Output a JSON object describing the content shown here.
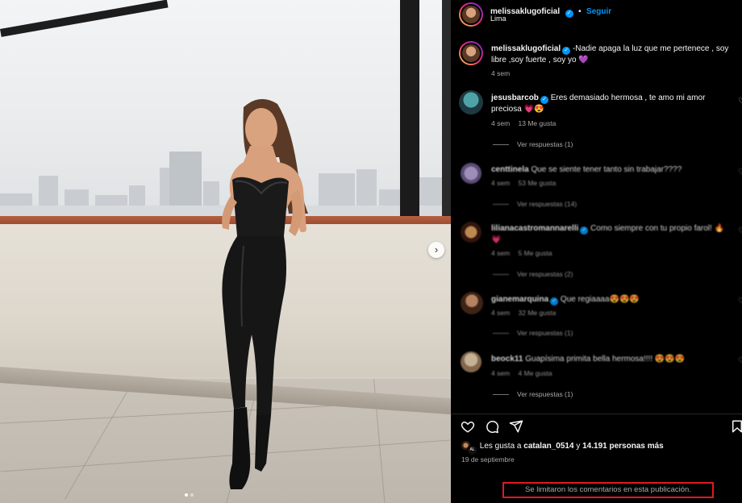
{
  "post": {
    "author": "melissaklugoficial",
    "location": "Lima",
    "follow_label": "Seguir",
    "caption": "-Nadie apaga la luz que me pertenece , soy libre ,soy fuerte , soy yo 💜",
    "caption_age": "4 sem",
    "carousel_index": 1,
    "carousel_total": 2
  },
  "comments": [
    {
      "user": "jesusbarcob",
      "verified": true,
      "text": "Eres demasiado hermosa , te amo mi amor preciosa 💗😍",
      "age": "4 sem",
      "likes": "13 Me gusta",
      "replies": "Ver respuestas (1)",
      "blurred": false
    },
    {
      "user": "centtinela",
      "verified": false,
      "text": "Que se siente tener tanto sin trabajar????",
      "age": "4 sem",
      "likes": "53 Me gusta",
      "replies": "Ver respuestas (14)",
      "blurred": true
    },
    {
      "user": "lilianacastromannarelli",
      "verified": true,
      "text": "Como siempre con tu propio farol! 🔥💗",
      "age": "4 sem",
      "likes": "5 Me gusta",
      "replies": "Ver respuestas (2)",
      "blurred": true
    },
    {
      "user": "gianemarquina",
      "verified": true,
      "text": "Que regiaaaa😍😍😍",
      "age": "4 sem",
      "likes": "32 Me gusta",
      "replies": "Ver respuestas (1)",
      "blurred": true
    },
    {
      "user": "beock11",
      "verified": false,
      "text": "Guapísima primita bella hermosa!!!! 😍😍😍",
      "age": "4 sem",
      "likes": "4 Me gusta",
      "replies": "Ver respuestas (1)",
      "blurred": true
    }
  ],
  "likes_line": {
    "prefix": "Les gusta a",
    "user": "catalan_0514",
    "joiner": "y",
    "count": "14.191 personas más"
  },
  "date": "19 de septiembre",
  "comments_limited": "Se limitaron los comentarios en esta publicación.",
  "colors": {
    "accent": "#0095f6",
    "highlight_border": "#e0191f",
    "muted": "#a8a8a8"
  },
  "icons": [
    "heart-icon",
    "comment-icon",
    "share-icon",
    "bookmark-icon",
    "chevron-right-icon",
    "verified-icon"
  ]
}
